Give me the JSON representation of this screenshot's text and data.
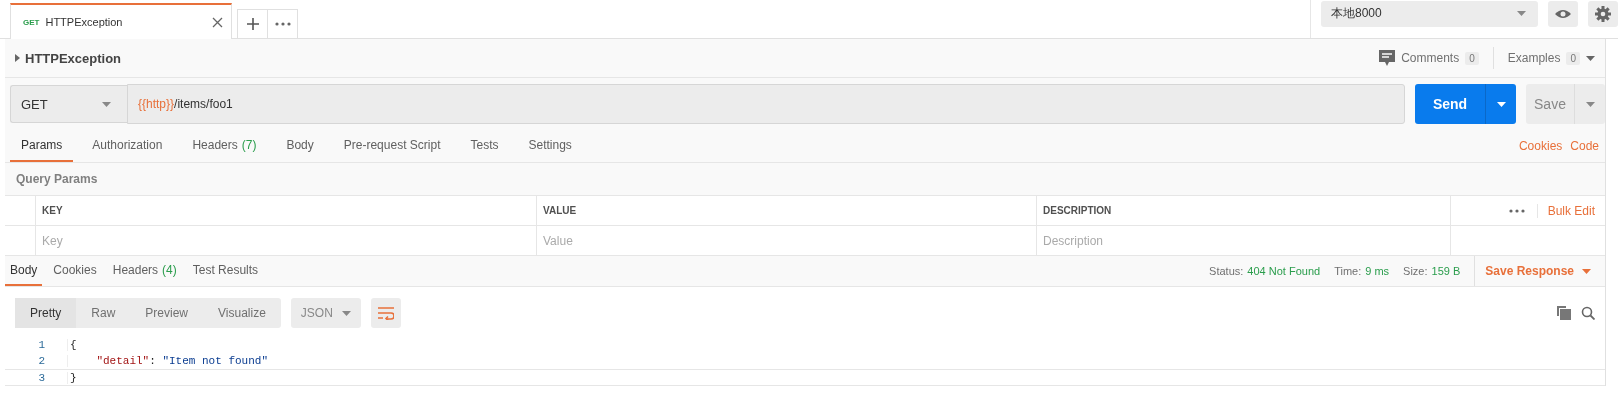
{
  "tab_bar": {
    "tabs": [
      {
        "method": "GET",
        "title": "HTTPException",
        "selected": true
      }
    ],
    "environment": "本地8000"
  },
  "request": {
    "name": "HTTPException",
    "comments": {
      "label": "Comments",
      "count": "0"
    },
    "examples": {
      "label": "Examples",
      "count": "0"
    },
    "method": "GET",
    "url": [
      {
        "kind": "variable",
        "text": "{{http}}"
      },
      {
        "kind": "text",
        "text": "/items/foo1"
      }
    ],
    "send": "Send",
    "save": "Save",
    "tabs": [
      {
        "label": "Params",
        "selected": true
      },
      {
        "label": "Authorization",
        "selected": false
      },
      {
        "label": "Headers",
        "count": "(7)",
        "selected": false
      },
      {
        "label": "Body",
        "selected": false
      },
      {
        "label": "Pre-request Script",
        "selected": false
      },
      {
        "label": "Tests",
        "selected": false
      },
      {
        "label": "Settings",
        "selected": false
      }
    ],
    "links": [
      "Cookies",
      "Code"
    ],
    "params": {
      "title": "Query Params",
      "columns": [
        "KEY",
        "VALUE",
        "DESCRIPTION"
      ],
      "placeholders": [
        "Key",
        "Value",
        "Description"
      ],
      "bulk_edit": "Bulk Edit"
    }
  },
  "response": {
    "tabs": [
      {
        "label": "Body",
        "selected": true
      },
      {
        "label": "Cookies",
        "selected": false
      },
      {
        "label": "Headers",
        "count": "(4)",
        "selected": false
      },
      {
        "label": "Test Results",
        "selected": false
      }
    ],
    "status": [
      {
        "label": "Status:",
        "value": "404 Not Found"
      },
      {
        "label": "Time:",
        "value": "9 ms"
      },
      {
        "label": "Size:",
        "value": "159 B"
      }
    ],
    "save_response": "Save Response",
    "views": [
      {
        "label": "Pretty",
        "selected": true
      },
      {
        "label": "Raw",
        "selected": false
      },
      {
        "label": "Preview",
        "selected": false
      },
      {
        "label": "Visualize",
        "selected": false
      }
    ],
    "format": "JSON",
    "lines": [
      {
        "number": "1",
        "active": false,
        "tokens": [
          {
            "kind": "punct",
            "text": "{"
          }
        ]
      },
      {
        "number": "2",
        "active": false,
        "tokens": [
          {
            "kind": "key",
            "text": "\"detail\""
          },
          {
            "kind": "punct",
            "text": ": "
          },
          {
            "kind": "string",
            "text": "\"Item not found\""
          }
        ]
      },
      {
        "number": "3",
        "active": true,
        "tokens": [
          {
            "kind": "punct",
            "text": "}"
          }
        ]
      }
    ]
  }
}
